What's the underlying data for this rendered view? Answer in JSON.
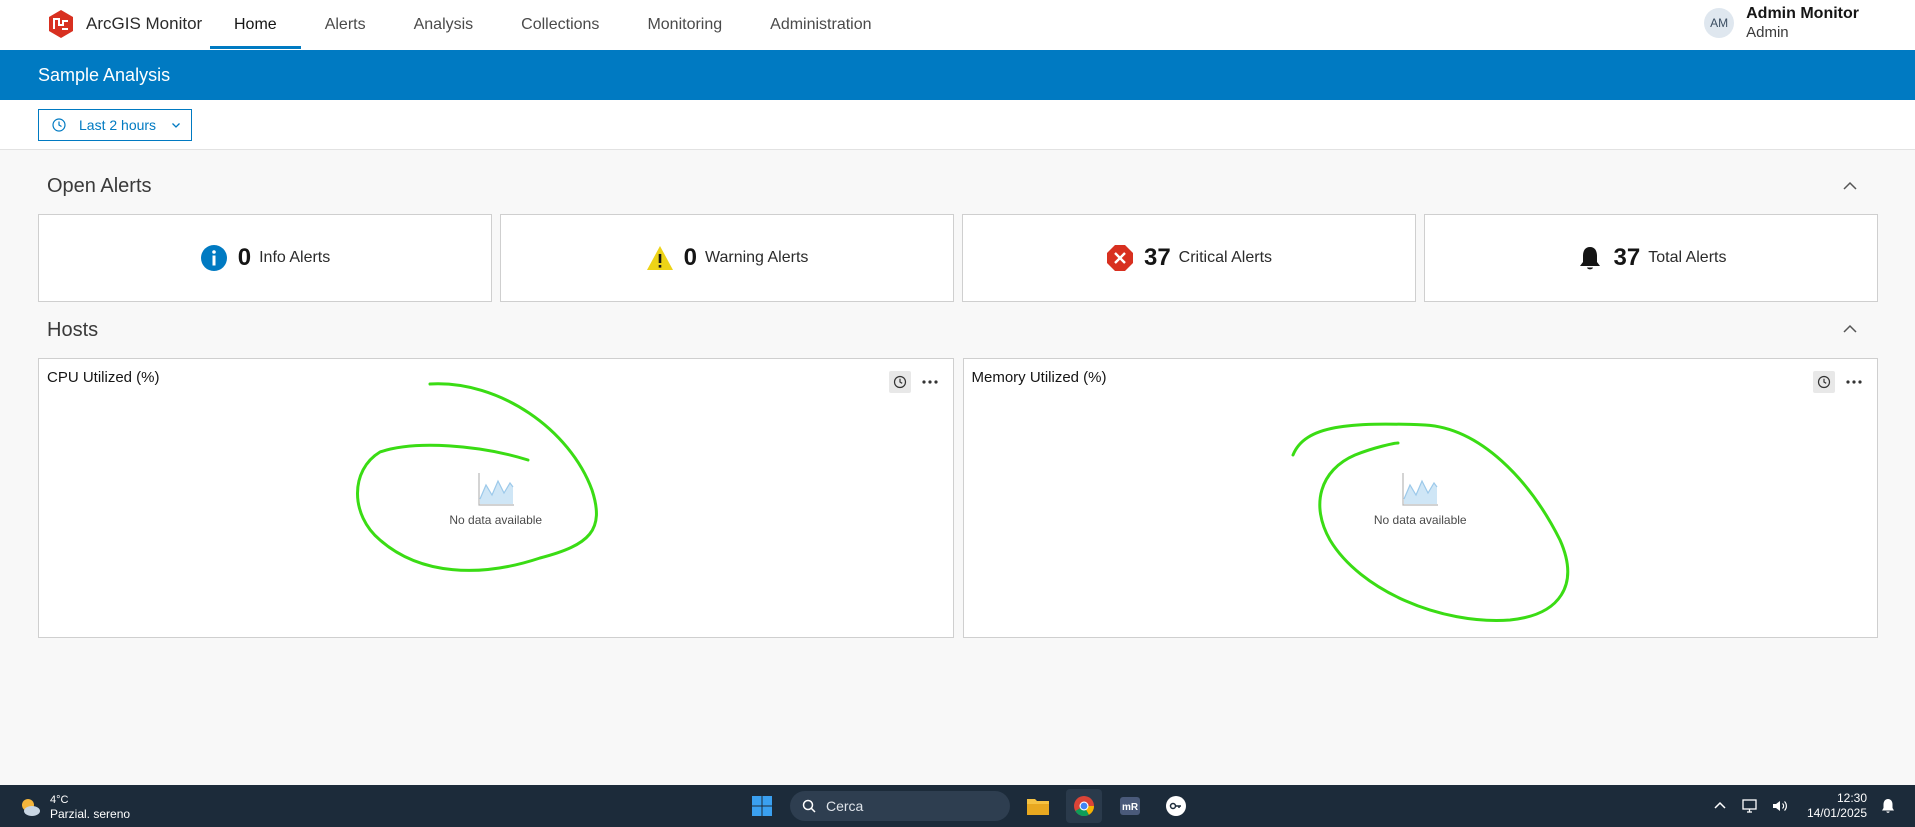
{
  "app": {
    "name": "ArcGIS Monitor"
  },
  "nav": {
    "tabs": [
      {
        "label": "Home",
        "active": true
      },
      {
        "label": "Alerts"
      },
      {
        "label": "Analysis"
      },
      {
        "label": "Collections"
      },
      {
        "label": "Monitoring"
      },
      {
        "label": "Administration"
      }
    ]
  },
  "user": {
    "initials": "AM",
    "name": "Admin Monitor",
    "role": "Admin"
  },
  "page": {
    "title": "Sample Analysis"
  },
  "time_filter": {
    "label": "Last 2 hours"
  },
  "open_alerts": {
    "title": "Open Alerts",
    "cards": [
      {
        "count": "0",
        "label": "Info Alerts",
        "icon": "info-icon",
        "color": "#007ac2"
      },
      {
        "count": "0",
        "label": "Warning Alerts",
        "icon": "warning-icon",
        "color": "#edd317"
      },
      {
        "count": "37",
        "label": "Critical Alerts",
        "icon": "critical-icon",
        "color": "#d83020"
      },
      {
        "count": "37",
        "label": "Total Alerts",
        "icon": "bell-icon",
        "color": "#151515"
      }
    ]
  },
  "hosts": {
    "title": "Hosts",
    "panels": [
      {
        "title": "CPU Utilized (%)",
        "empty_text": "No data available"
      },
      {
        "title": "Memory Utilized (%)",
        "empty_text": "No data available"
      }
    ]
  },
  "annotation": {
    "color": "#3adc14"
  },
  "taskbar": {
    "weather": {
      "temp": "4°C",
      "desc": "Parzial. sereno"
    },
    "search_placeholder": "Cerca",
    "time": "12:30",
    "date": "14/01/2025"
  },
  "colors": {
    "brand": "#007ac2",
    "logo": "#d83020",
    "taskbar": "#1c2b3a"
  }
}
